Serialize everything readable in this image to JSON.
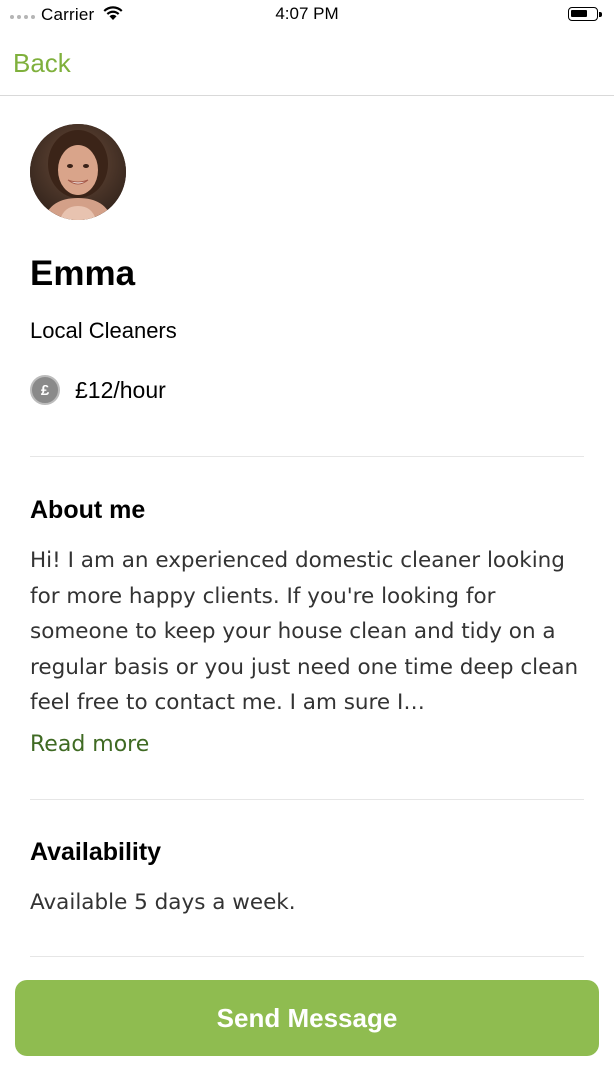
{
  "status_bar": {
    "carrier": "Carrier",
    "time": "4:07 PM",
    "wifi_icon": "wifi-icon",
    "battery_icon": "battery-icon"
  },
  "nav": {
    "back_label": "Back"
  },
  "profile": {
    "avatar_icon": "avatar-photo",
    "name": "Emma",
    "company": "Local Cleaners",
    "rate_icon": "pound-icon",
    "rate_symbol": "£",
    "rate": "£12/hour"
  },
  "about": {
    "title": "About me",
    "text": "Hi! I am an experienced domestic cleaner looking for more happy clients. If you're looking for someone to keep your house clean and tidy on a regular basis or you just need one time deep clean feel free to contact me. I am sure I…",
    "read_more": "Read more"
  },
  "availability": {
    "title": "Availability",
    "text": "Available 5 days a week."
  },
  "action": {
    "send_label": "Send Message"
  },
  "colors": {
    "accent": "#8fbc50",
    "link_green": "#3f6a23",
    "back_green": "#7fb03c"
  }
}
